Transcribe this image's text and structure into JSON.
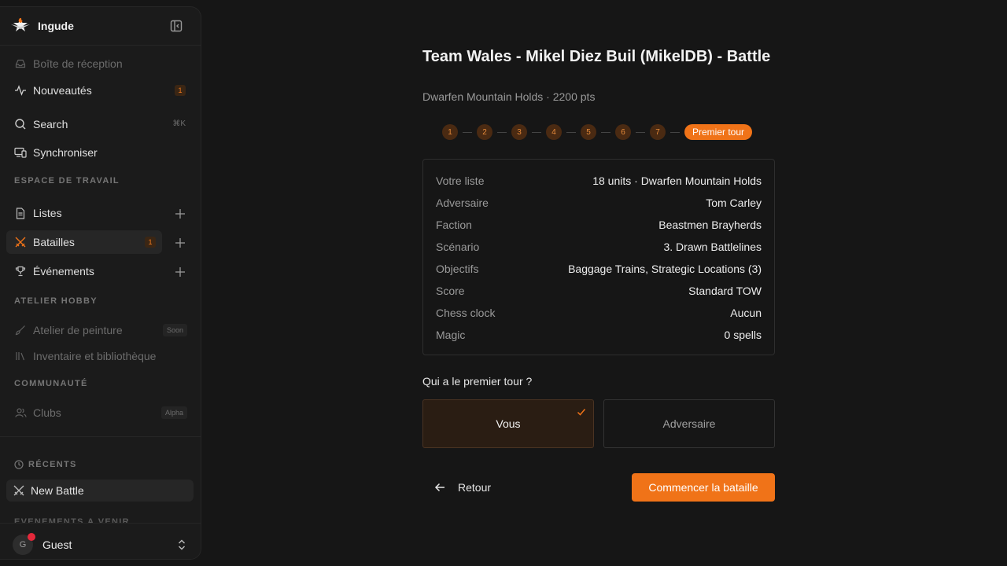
{
  "app": {
    "name": "Ingude"
  },
  "sidebar": {
    "top_items": [
      {
        "label": "Boîte de réception",
        "icon": "inbox-icon"
      },
      {
        "label": "Nouveautés",
        "icon": "activity-icon",
        "badge": "1"
      },
      {
        "label": "Search",
        "icon": "search-icon",
        "shortcut": "⌘K"
      },
      {
        "label": "Synchroniser",
        "icon": "devices-icon"
      }
    ],
    "workspace": {
      "title": "ESPACE DE TRAVAIL",
      "items": [
        {
          "label": "Listes",
          "icon": "file-icon"
        },
        {
          "label": "Batailles",
          "icon": "swords-icon",
          "badge": "1"
        },
        {
          "label": "Événements",
          "icon": "trophy-icon"
        }
      ]
    },
    "hobby": {
      "title": "ATELIER HOBBY",
      "items": [
        {
          "label": "Atelier de peinture",
          "icon": "brush-icon",
          "chip": "Soon"
        },
        {
          "label": "Inventaire et bibliothèque",
          "icon": "library-icon"
        }
      ]
    },
    "community": {
      "title": "COMMUNAUTÉ",
      "items": [
        {
          "label": "Clubs",
          "icon": "users-icon",
          "chip": "Alpha"
        }
      ]
    },
    "recent": {
      "title": "RÉCENTS",
      "items": [
        {
          "label": "New Battle",
          "icon": "swords-icon"
        }
      ]
    },
    "upcoming": {
      "title": "ÉVÉNEMENTS À VENIR"
    },
    "user": {
      "initial": "G",
      "name": "Guest"
    }
  },
  "main": {
    "title": "Team Wales - Mikel Diez Buil (MikelDB) - Battle",
    "subtitle": "Dwarfen Mountain Holds · 2200 pts",
    "steps": [
      "1",
      "2",
      "3",
      "4",
      "5",
      "6",
      "7"
    ],
    "current_step": "Premier tour",
    "summary": [
      {
        "label": "Votre liste",
        "value": "18 units · Dwarfen Mountain Holds"
      },
      {
        "label": "Adversaire",
        "value": "Tom Carley"
      },
      {
        "label": "Faction",
        "value": "Beastmen Brayherds"
      },
      {
        "label": "Scénario",
        "value": "3. Drawn Battlelines"
      },
      {
        "label": "Objectifs",
        "value": "Baggage Trains, Strategic Locations (3)"
      },
      {
        "label": "Score",
        "value": "Standard TOW"
      },
      {
        "label": "Chess clock",
        "value": "Aucun"
      },
      {
        "label": "Magic",
        "value": "0 spells"
      }
    ],
    "question": "Qui a le premier tour ?",
    "choices": {
      "selected": "Vous",
      "other": "Adversaire"
    },
    "back_label": "Retour",
    "start_label": "Commencer la bataille"
  },
  "colors": {
    "accent": "#f07318",
    "background": "#161616",
    "sidebar": "#1b1b1b"
  }
}
